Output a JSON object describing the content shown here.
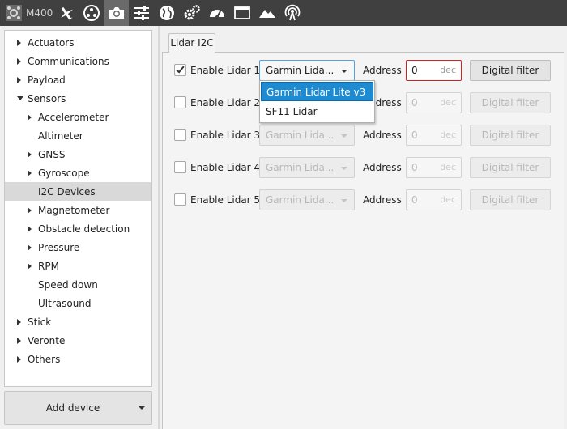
{
  "toolbar": {
    "vehicle_name": "M400",
    "icons": [
      "drone-icon",
      "airplane-icon",
      "propeller-icon",
      "camera-icon",
      "sliders-icon",
      "globe-icon",
      "gears-icon",
      "gauge-icon",
      "window-icon",
      "mountain-icon",
      "broadcast-icon"
    ],
    "active": "camera-icon"
  },
  "sidebar": {
    "items": [
      {
        "label": "Actuators",
        "arrow": "right"
      },
      {
        "label": "Communications",
        "arrow": "right"
      },
      {
        "label": "Payload",
        "arrow": "right"
      },
      {
        "label": "Sensors",
        "arrow": "down"
      },
      {
        "label": "Accelerometer",
        "arrow": "right"
      },
      {
        "label": "Altimeter",
        "arrow": "none"
      },
      {
        "label": "GNSS",
        "arrow": "right"
      },
      {
        "label": "Gyroscope",
        "arrow": "right"
      },
      {
        "label": "I2C Devices",
        "arrow": "none"
      },
      {
        "label": "Magnetometer",
        "arrow": "right"
      },
      {
        "label": "Obstacle detection",
        "arrow": "right"
      },
      {
        "label": "Pressure",
        "arrow": "right"
      },
      {
        "label": "RPM",
        "arrow": "right"
      },
      {
        "label": "Speed down",
        "arrow": "none"
      },
      {
        "label": "Ultrasound",
        "arrow": "none"
      },
      {
        "label": "Stick",
        "arrow": "right"
      },
      {
        "label": "Veronte",
        "arrow": "right"
      },
      {
        "label": "Others",
        "arrow": "right"
      }
    ],
    "selected": "I2C Devices",
    "add_device_label": "Add device"
  },
  "main": {
    "tab_label": "Lidar I2C",
    "address_label": "Address",
    "address_unit": "dec",
    "filter_label": "Digital filter",
    "rows": [
      {
        "label": "Enable Lidar 1",
        "checked": true,
        "model": "Garmin Lida...",
        "address": "0"
      },
      {
        "label": "Enable Lidar 2",
        "checked": false,
        "model": "Garmin Lida...",
        "address": "0"
      },
      {
        "label": "Enable Lidar 3",
        "checked": false,
        "model": "Garmin Lida...",
        "address": "0"
      },
      {
        "label": "Enable Lidar 4",
        "checked": false,
        "model": "Garmin Lida...",
        "address": "0"
      },
      {
        "label": "Enable Lidar 5",
        "checked": false,
        "model": "Garmin Lida...",
        "address": "0"
      }
    ],
    "dropdown_options": [
      "Garmin Lidar Lite v3",
      "SF11 Lidar"
    ],
    "dropdown_selected": "Garmin Lidar Lite v3"
  }
}
